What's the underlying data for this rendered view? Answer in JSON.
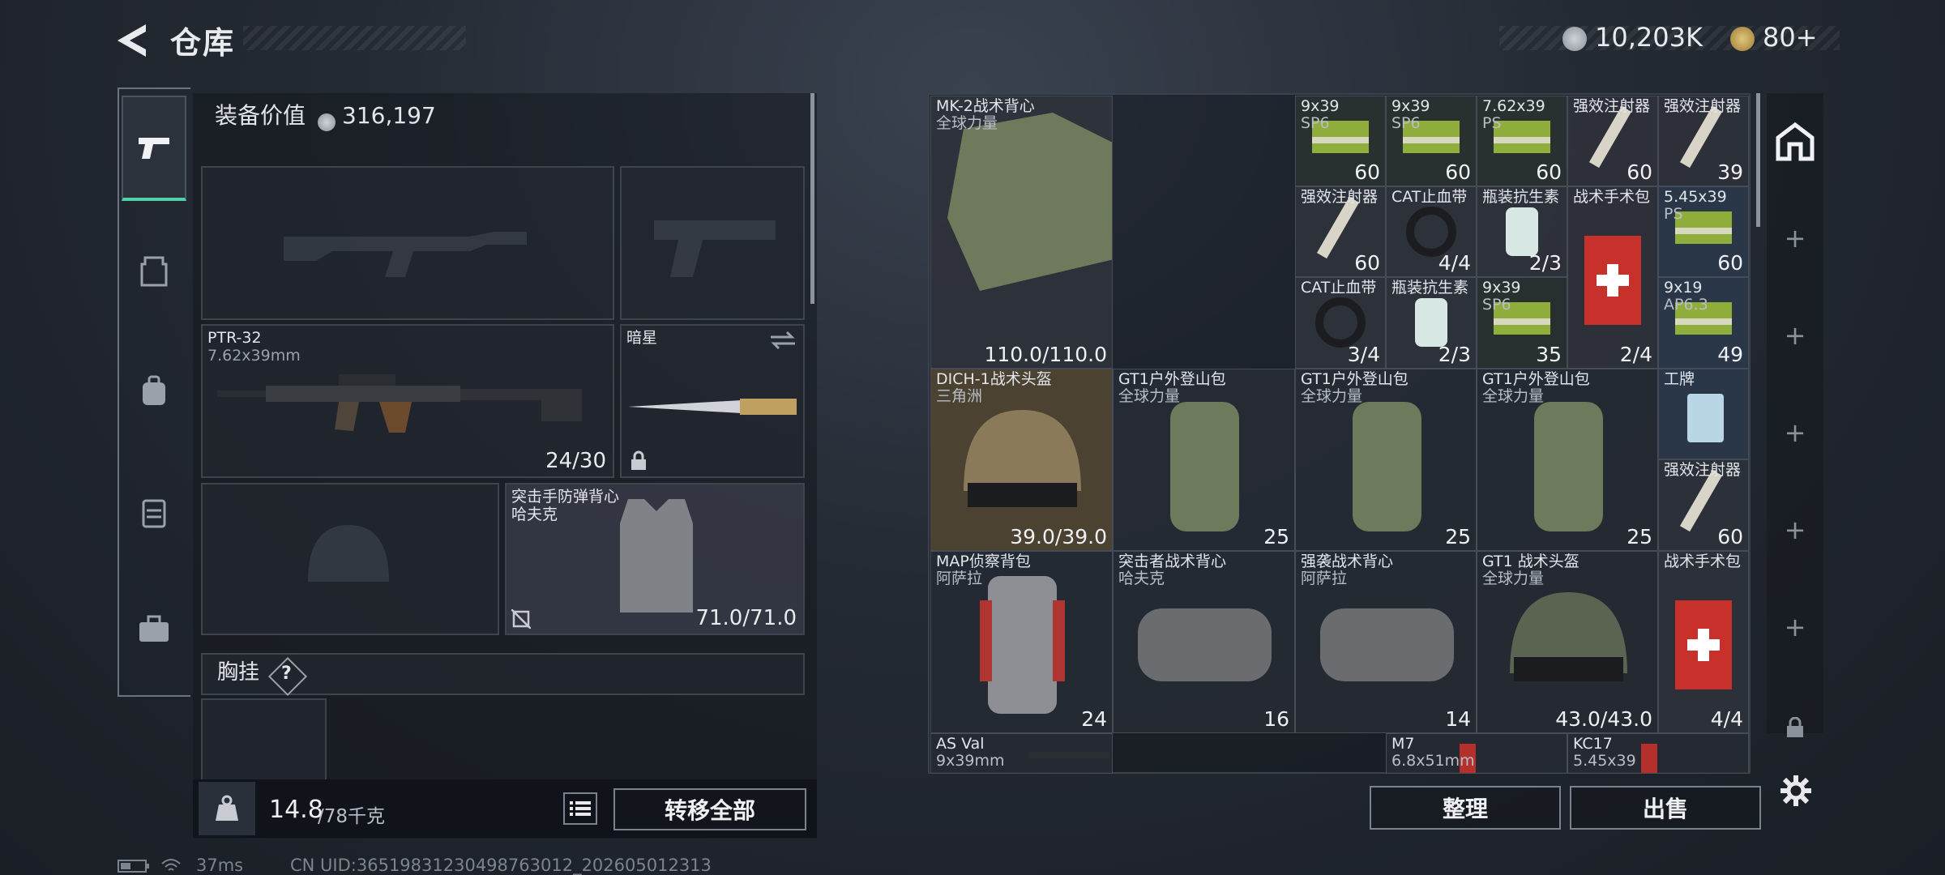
{
  "header": {
    "title": "仓库",
    "currency_1": "10,203K",
    "currency_2": "80+"
  },
  "equipment": {
    "value_label": "装备价值",
    "value": "316,197",
    "primary": {
      "name": "PTR-32",
      "caliber": "7.62x39mm",
      "ammo": "24/30"
    },
    "melee": {
      "name": "暗星"
    },
    "armor": {
      "name": "突击手防弹背心",
      "brand": "哈夫克",
      "durability": "71.0/71.0"
    },
    "chest_rig_label": "胸挂",
    "chest_rig_help": "?",
    "weight_value": "14.8",
    "weight_max": "/78千克",
    "transfer_all": "转移全部"
  },
  "stash": {
    "items": [
      {
        "name": "MK-2战术背心",
        "sub": "全球力量",
        "num": "110.0/110.0"
      },
      {
        "name": "9x39",
        "sub": "SP6",
        "num": "60"
      },
      {
        "name": "9x39",
        "sub": "SP6",
        "num": "60"
      },
      {
        "name": "7.62x39",
        "sub": "PS",
        "num": "60"
      },
      {
        "name": "强效注射器",
        "sub": "",
        "num": "60"
      },
      {
        "name": "强效注射器",
        "sub": "",
        "num": "39"
      },
      {
        "name": "强效注射器",
        "sub": "",
        "num": "60"
      },
      {
        "name": "CAT止血带",
        "sub": "",
        "num": "4/4"
      },
      {
        "name": "瓶装抗生素",
        "sub": "",
        "num": "2/3"
      },
      {
        "name": "战术手术包",
        "sub": "",
        "num": "2/4"
      },
      {
        "name": "5.45x39",
        "sub": "PS",
        "num": "60"
      },
      {
        "name": "CAT止血带",
        "sub": "",
        "num": "3/4"
      },
      {
        "name": "瓶装抗生素",
        "sub": "",
        "num": "2/3"
      },
      {
        "name": "9x39",
        "sub": "SP6",
        "num": "35"
      },
      {
        "name": "9x19",
        "sub": "AP6.3",
        "num": "49"
      },
      {
        "name": "DICH-1战术头盔",
        "sub": "三角洲",
        "num": "39.0/39.0"
      },
      {
        "name": "GT1户外登山包",
        "sub": "全球力量",
        "num": "25"
      },
      {
        "name": "GT1户外登山包",
        "sub": "全球力量",
        "num": "25"
      },
      {
        "name": "GT1户外登山包",
        "sub": "全球力量",
        "num": "25"
      },
      {
        "name": "工牌",
        "sub": "",
        "num": ""
      },
      {
        "name": "强效注射器",
        "sub": "",
        "num": "60"
      },
      {
        "name": "MAP侦察背包",
        "sub": "阿萨拉",
        "num": "24"
      },
      {
        "name": "突击者战术背心",
        "sub": "哈夫克",
        "num": "16"
      },
      {
        "name": "强袭战术背心",
        "sub": "阿萨拉",
        "num": "14"
      },
      {
        "name": "GT1 战术头盔",
        "sub": "全球力量",
        "num": "43.0/43.0"
      },
      {
        "name": "战术手术包",
        "sub": "",
        "num": "4/4"
      },
      {
        "name": "AS Val",
        "sub": "9x39mm",
        "num": ""
      },
      {
        "name": "M7",
        "sub": "6.8x51mm",
        "num": ""
      },
      {
        "name": "KC17",
        "sub": "5.45x39",
        "num": ""
      }
    ],
    "sort_button": "整理",
    "sell_button": "出售"
  },
  "footer": {
    "ping": "37ms",
    "uid": "CN UID:3651983123049876301​2_202605012313"
  }
}
